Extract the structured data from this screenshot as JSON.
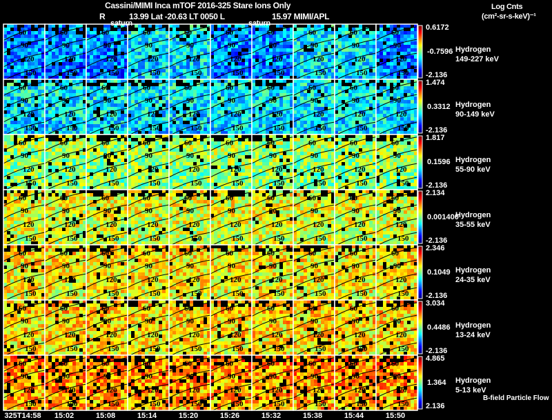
{
  "header": {
    "title": "Cassini/MIMI Inca mTOF  2016-325   Stare   Ions Only",
    "subtitle_left": "R",
    "subtitle_mid": "13.99 Lat -20.63 LT 0050 L",
    "subtitle_right": "15.97  MIMI/APL",
    "units_line1": "Log Cnts",
    "units_line2": "(cm²-sr-s-keV)⁻¹"
  },
  "footer_note": "B-field Particle Flow",
  "chart_data": {
    "type": "heatmap",
    "colormap": "jet",
    "grid": {
      "columns": 10,
      "rows": 7
    },
    "time_labels": [
      "325T14:58",
      "15:02",
      "15:08",
      "15:14",
      "15:20",
      "15:26",
      "15:32",
      "15:38",
      "15:44",
      "15:50"
    ],
    "contour_labels": [
      "60",
      "90",
      "120",
      "150"
    ],
    "annotations": [
      {
        "text": "saturn",
        "column": 3
      },
      {
        "text": "saturn",
        "column": 6
      }
    ],
    "rows": [
      {
        "species": "Hydrogen",
        "energy": "149-227 keV",
        "cbar_max": "0.6172",
        "cbar_mid": "-0.7596",
        "cbar_min": "-2.136"
      },
      {
        "species": "Hydrogen",
        "energy": "90-149 keV",
        "cbar_max": "1.474",
        "cbar_mid": "0.3312",
        "cbar_min": "-2.136"
      },
      {
        "species": "Hydrogen",
        "energy": "55-90 keV",
        "cbar_max": "1.817",
        "cbar_mid": "0.1596",
        "cbar_min": "-2.136"
      },
      {
        "species": "Hydrogen",
        "energy": "35-55 keV",
        "cbar_max": "2.134",
        "cbar_mid": "0.001400",
        "cbar_min": "-2.136"
      },
      {
        "species": "Hydrogen",
        "energy": "24-35 keV",
        "cbar_max": "2.346",
        "cbar_mid": "0.1049",
        "cbar_min": "-2.136"
      },
      {
        "species": "Hydrogen",
        "energy": "13-24 keV",
        "cbar_max": "3.034",
        "cbar_mid": "0.4486",
        "cbar_min": "-2.136"
      },
      {
        "species": "Hydrogen",
        "energy": "5-13 keV",
        "cbar_max": "4.865",
        "cbar_mid": "1.364",
        "cbar_min": "2.136"
      }
    ]
  }
}
